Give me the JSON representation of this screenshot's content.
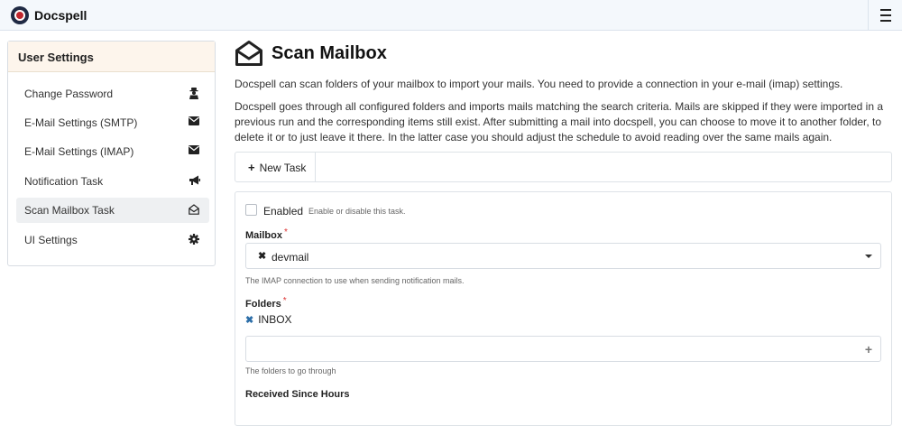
{
  "app": {
    "brand": "Docspell"
  },
  "sidebar": {
    "title": "User Settings",
    "items": [
      {
        "label": "Change Password",
        "icon": "user-secret-icon"
      },
      {
        "label": "E-Mail Settings (SMTP)",
        "icon": "envelope-icon"
      },
      {
        "label": "E-Mail Settings (IMAP)",
        "icon": "envelope-icon"
      },
      {
        "label": "Notification Task",
        "icon": "bullhorn-icon"
      },
      {
        "label": "Scan Mailbox Task",
        "icon": "envelope-open-icon",
        "active": true
      },
      {
        "label": "UI Settings",
        "icon": "cog-icon"
      }
    ]
  },
  "main": {
    "title": "Scan Mailbox",
    "intro": "Docspell can scan folders of your mailbox to import your mails. You need to provide a connection in your e-mail (imap) settings.",
    "description": "Docspell goes through all configured folders and imports mails matching the search criteria. Mails are skipped if they were imported in a previous run and the corresponding items still exist. After submitting a mail into docspell, you can choose to move it to another folder, to delete it or to just leave it there. In the latter case you should adjust the schedule to avoid reading over the same mails again.",
    "new_task_label": "New Task"
  },
  "form": {
    "enabled_label": "Enabled",
    "enabled_help": "Enable or disable this task.",
    "mailbox_label": "Mailbox",
    "mailbox_required": "*",
    "mailbox_value": "devmail",
    "mailbox_help": "The IMAP connection to use when sending notification mails.",
    "folders_label": "Folders",
    "folders_required": "*",
    "folders": [
      "INBOX"
    ],
    "folders_help": "The folders to go through",
    "received_label": "Received Since Hours"
  }
}
